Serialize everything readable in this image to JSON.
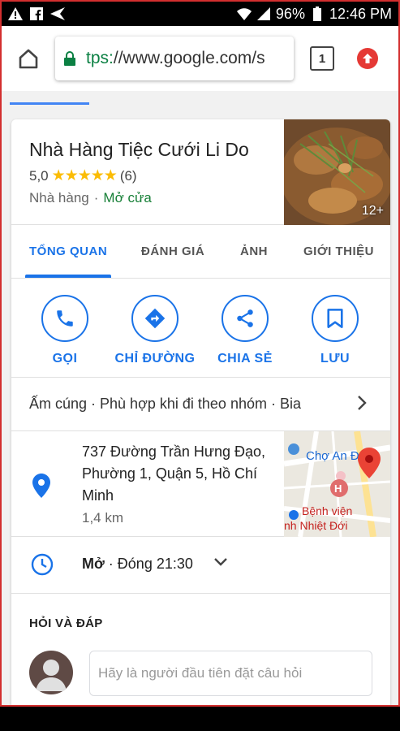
{
  "status_bar": {
    "battery": "96%",
    "time": "12:46 PM"
  },
  "browser": {
    "url_scheme": "tps:",
    "url_rest": "//www.google.com/s",
    "tab_count": "1"
  },
  "place": {
    "name": "Nhà Hàng Tiệc Cưới Li Do",
    "rating": "5,0",
    "stars": "★★★★★",
    "review_count": "(6)",
    "category": "Nhà hàng",
    "open_status": "Mở cửa",
    "photo_count": "12+"
  },
  "tabs": [
    {
      "label": "TỔNG QUAN",
      "active": true
    },
    {
      "label": "ĐÁNH GIÁ",
      "active": false
    },
    {
      "label": "ẢNH",
      "active": false
    },
    {
      "label": "GIỚI THIỆU",
      "active": false
    }
  ],
  "actions": [
    {
      "label": "GỌI",
      "icon": "phone-icon"
    },
    {
      "label": "CHỈ ĐƯỜNG",
      "icon": "directions-icon"
    },
    {
      "label": "CHIA SẺ",
      "icon": "share-icon"
    },
    {
      "label": "LƯU",
      "icon": "bookmark-icon"
    }
  ],
  "highlights": "Ấm cúng · Phù hợp khi đi theo nhóm · Bia",
  "address": {
    "line": "737 Đường Trần Hưng Đạo, Phường 1, Quận 5, Hồ Chí Minh",
    "distance": "1,4 km"
  },
  "map": {
    "label_market": "Chợ An Đông",
    "label_hospital_1": "Bệnh viện",
    "label_hospital_2": "nh Nhiệt Đới"
  },
  "hours": {
    "state": "Mở",
    "closing": "Đóng 21:30"
  },
  "qa": {
    "heading": "HỎI VÀ ĐÁP",
    "placeholder": "Hãy là người đầu tiên đặt câu hỏi"
  },
  "colors": {
    "accent": "#1a73e8",
    "open": "#188038",
    "star": "#fbbc04"
  }
}
